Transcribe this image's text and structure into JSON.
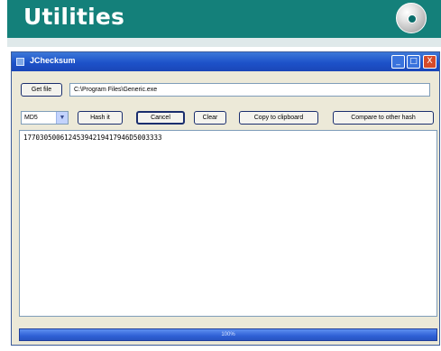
{
  "banner": {
    "title": "Utilities"
  },
  "window": {
    "title": "JChecksum",
    "controls": {
      "minimize": "_",
      "maximize": "□",
      "close": "X"
    }
  },
  "file_row": {
    "get_file_label": "Get file",
    "path_value": "C:\\Program Files\\Generic.exe"
  },
  "toolbar": {
    "algorithm_selected": "MD5",
    "hash_it_label": "Hash it",
    "cancel_label": "Cancel",
    "clear_label": "Clear",
    "copy_label": "Copy to clipboard",
    "compare_label": "Compare to other hash"
  },
  "output": {
    "hash_text": "17703050061245394219417946D5003333"
  },
  "progress": {
    "percent": 100,
    "label": "100%"
  },
  "colors": {
    "banner": "#14807a",
    "titlebar": "#1d52c9",
    "window_bg": "#ece9d8",
    "close": "#d64b2a"
  },
  "icons": {
    "disc": "cd-disc-icon",
    "app": "window-app-icon"
  }
}
